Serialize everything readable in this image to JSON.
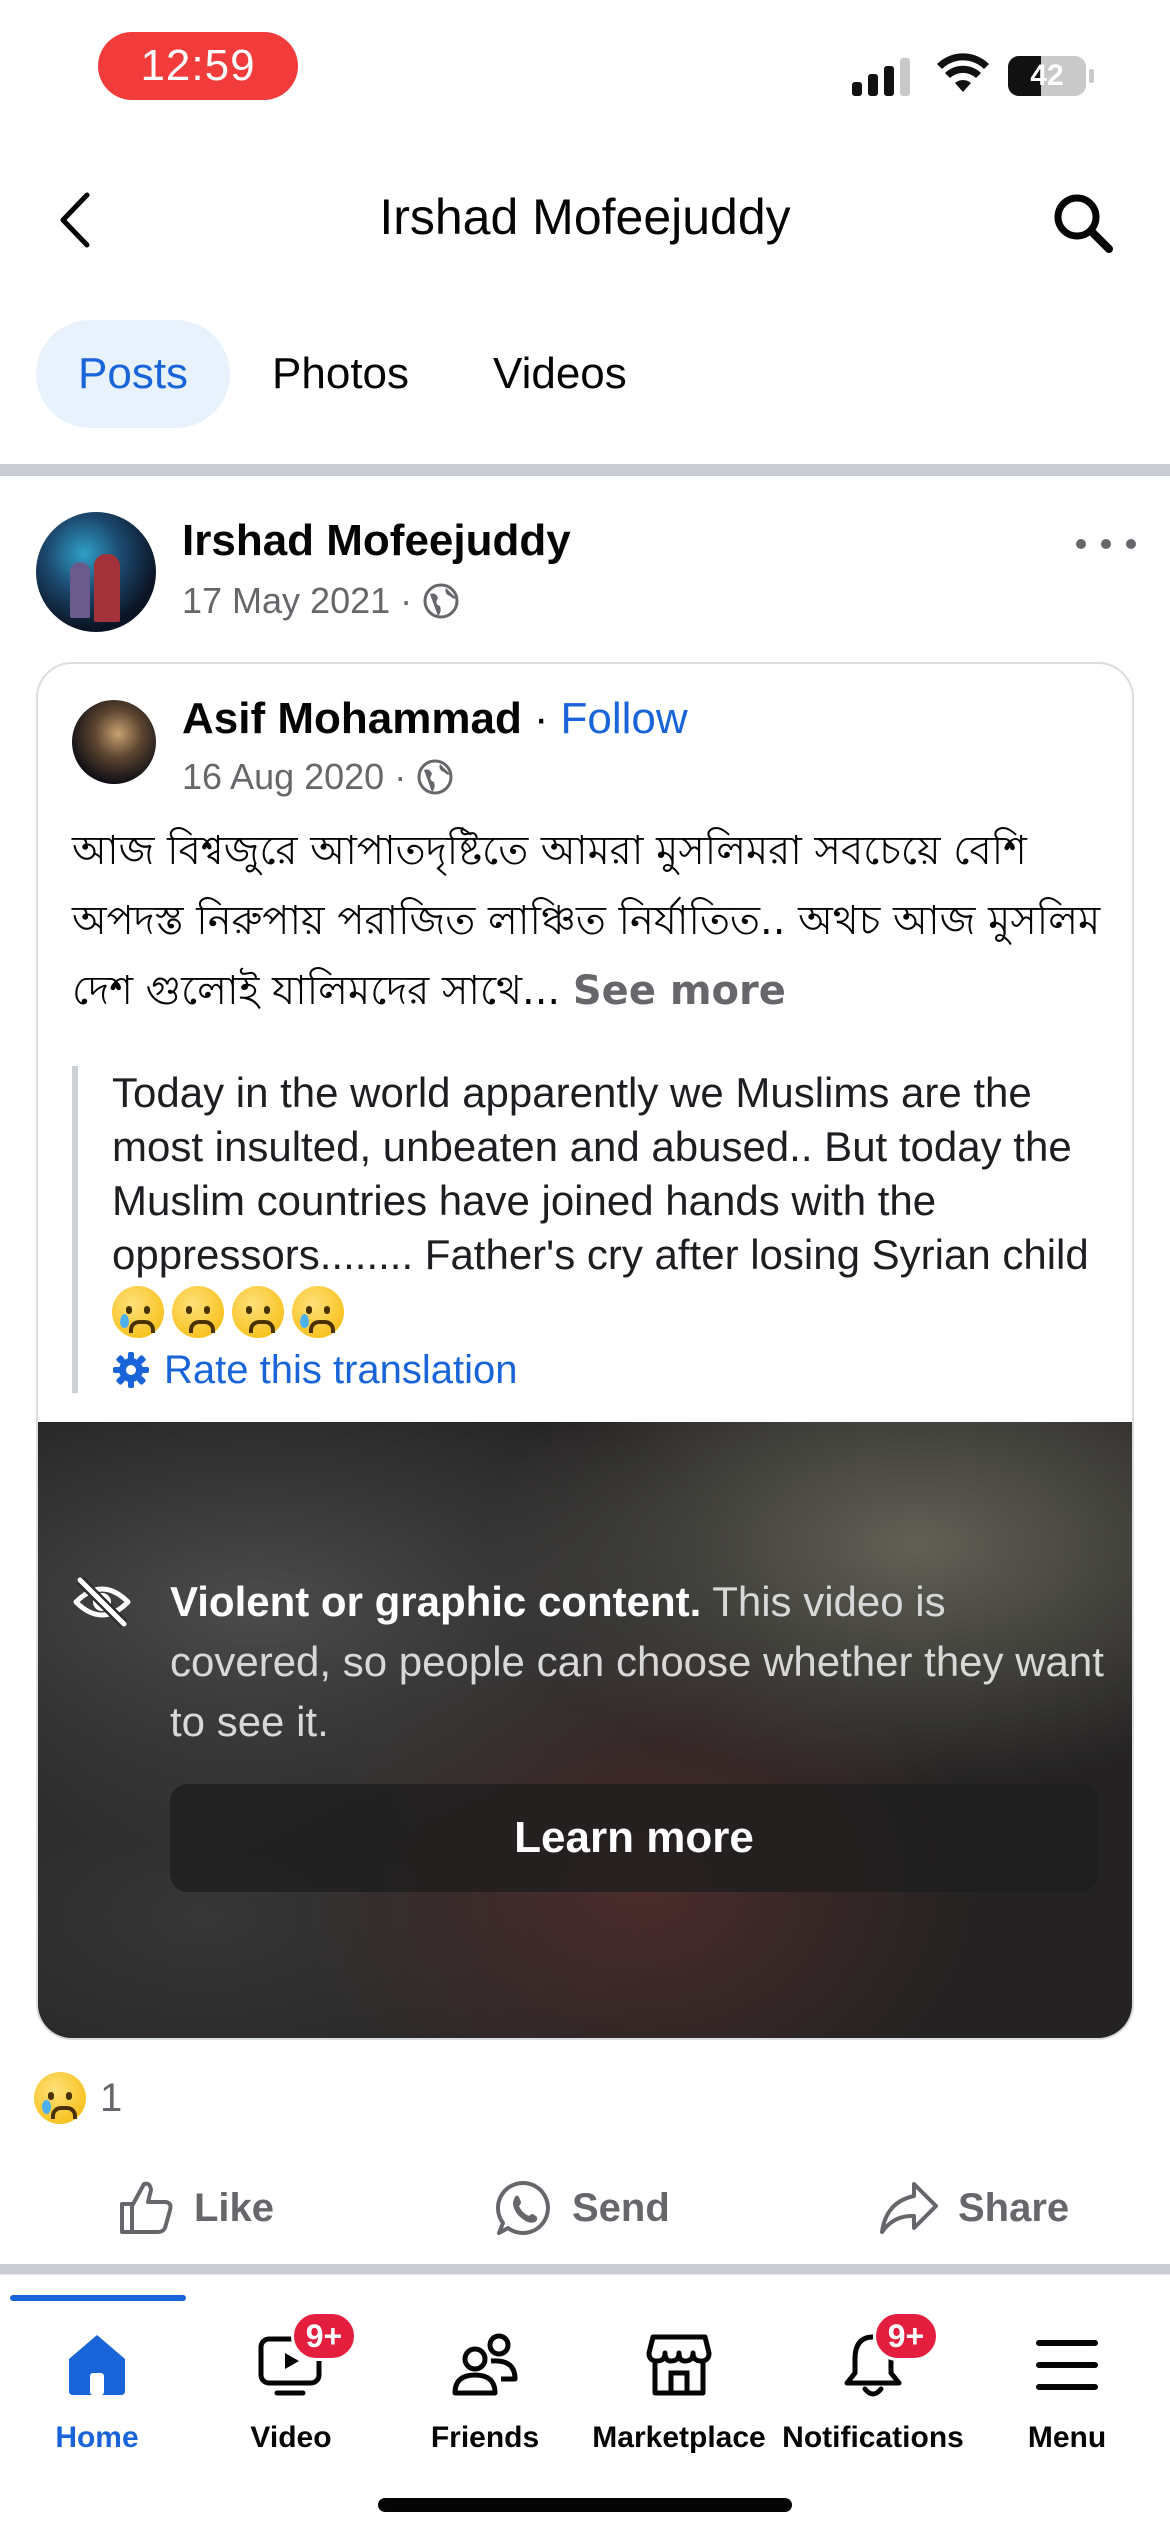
{
  "status_bar": {
    "time": "12:59",
    "battery": "42"
  },
  "header": {
    "title": "Irshad Mofeejuddy"
  },
  "tabs": [
    {
      "label": "Posts",
      "active": true
    },
    {
      "label": "Photos",
      "active": false
    },
    {
      "label": "Videos",
      "active": false
    }
  ],
  "post": {
    "author": "Irshad Mofeejuddy",
    "date": "17 May 2021",
    "separator": "·",
    "shared": {
      "author": "Asif Mohammad",
      "follow_label": "Follow",
      "date": "16 Aug 2020",
      "original_text": "আজ বিশ্বজুরে আপাতদৃষ্টিতে আমরা মুসলিমরা সবচেয়ে বেশি অপদস্ত নিরুপায় পরাজিত লাঞ্চিত নির্যাতিত.. অথচ আজ মুসলিম দেশ গুলোই যালিমদের সাথে...",
      "see_more": "See more",
      "translation": "Today in the world apparently we Muslims are the most insulted, unbeaten and abused.. But today the Muslim countries have joined hands with the oppressors........ Father's cry after losing Syrian child",
      "rate_translation": "Rate this translation",
      "warning_title": "Violent or graphic content.",
      "warning_body": "This video is covered, so people can choose whether they want to see it.",
      "learn_more": "Learn more"
    },
    "reaction_count": "1",
    "actions": {
      "like": "Like",
      "send": "Send",
      "share": "Share"
    }
  },
  "bottom_nav": [
    {
      "label": "Home",
      "icon": "home-icon",
      "active": true,
      "badge": ""
    },
    {
      "label": "Video",
      "icon": "video-icon",
      "active": false,
      "badge": "9+"
    },
    {
      "label": "Friends",
      "icon": "friends-icon",
      "active": false,
      "badge": ""
    },
    {
      "label": "Marketplace",
      "icon": "marketplace-icon",
      "active": false,
      "badge": ""
    },
    {
      "label": "Notifications",
      "icon": "bell-icon",
      "active": false,
      "badge": "9+"
    },
    {
      "label": "Menu",
      "icon": "menu-icon",
      "active": false,
      "badge": ""
    }
  ],
  "colors": {
    "accent": "#1864d8",
    "badge": "#e41e3f",
    "time_pill": "#f23b3b",
    "secondary_text": "#65676b"
  }
}
